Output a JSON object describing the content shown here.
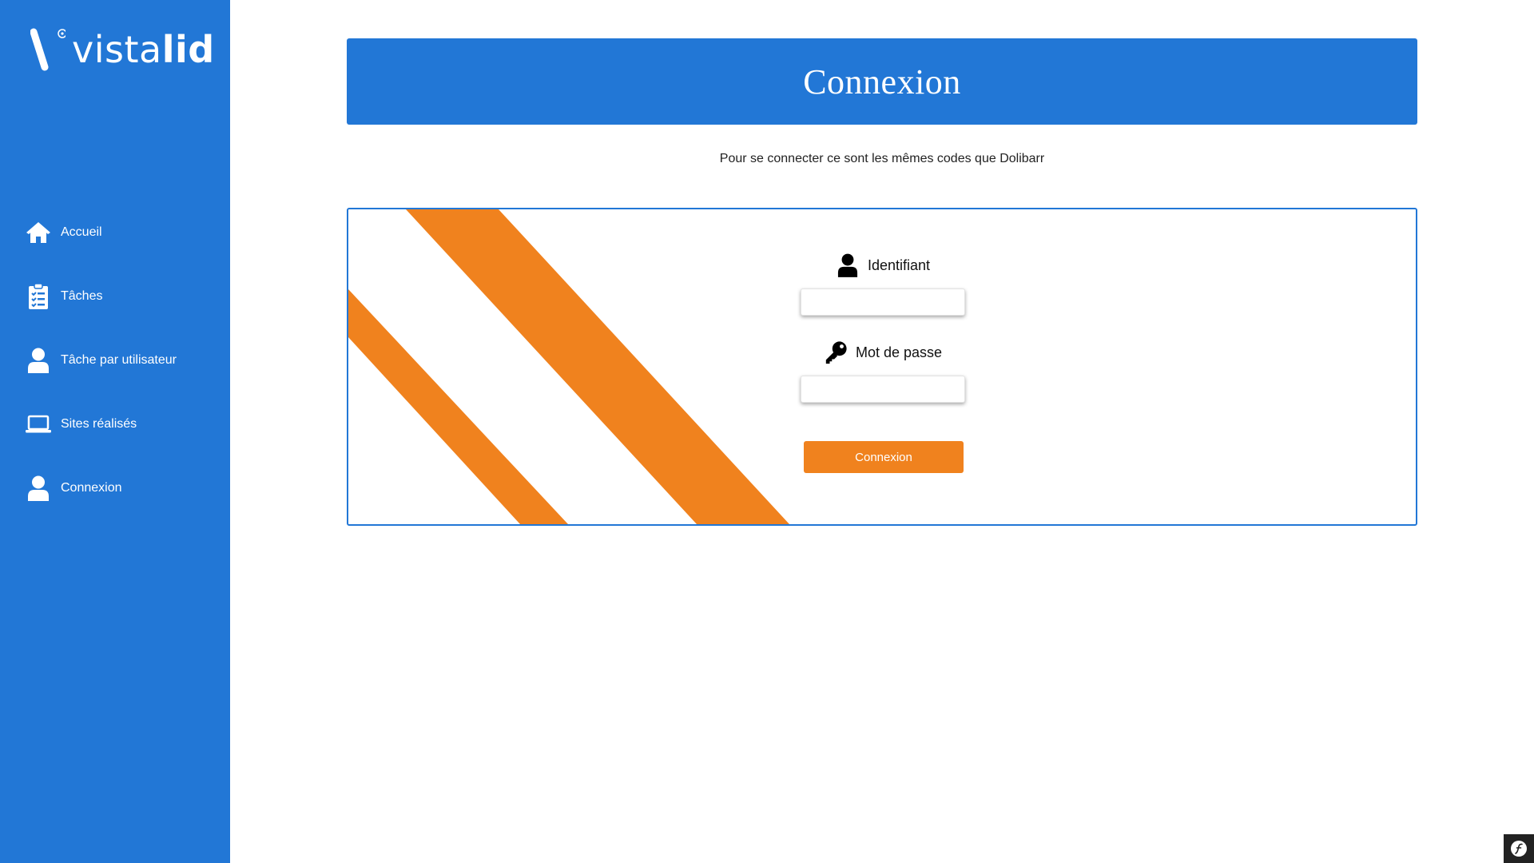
{
  "brand": {
    "logo_text_light": "vista",
    "logo_text_bold": "lid",
    "sidebar_color": "#2277d6",
    "accent_color": "#f0821e"
  },
  "sidebar": {
    "items": [
      {
        "label": "Accueil",
        "icon": "home-icon"
      },
      {
        "label": "Tâches",
        "icon": "clipboard-list-icon"
      },
      {
        "label": "Tâche par utilisateur",
        "icon": "user-icon"
      },
      {
        "label": "Sites réalisés",
        "icon": "laptop-icon"
      },
      {
        "label": "Connexion",
        "icon": "user-icon"
      }
    ]
  },
  "header": {
    "title": "Connexion"
  },
  "subtitle": "Pour se connecter ce sont les mêmes codes que Dolibarr",
  "login_form": {
    "username_label": "Identifiant",
    "username_icon": "user-icon",
    "username_value": "",
    "password_label": "Mot de passe",
    "password_icon": "key-icon",
    "password_value": "",
    "submit_label": "Connexion"
  },
  "toolbar": {
    "icon": "symfony-icon"
  }
}
